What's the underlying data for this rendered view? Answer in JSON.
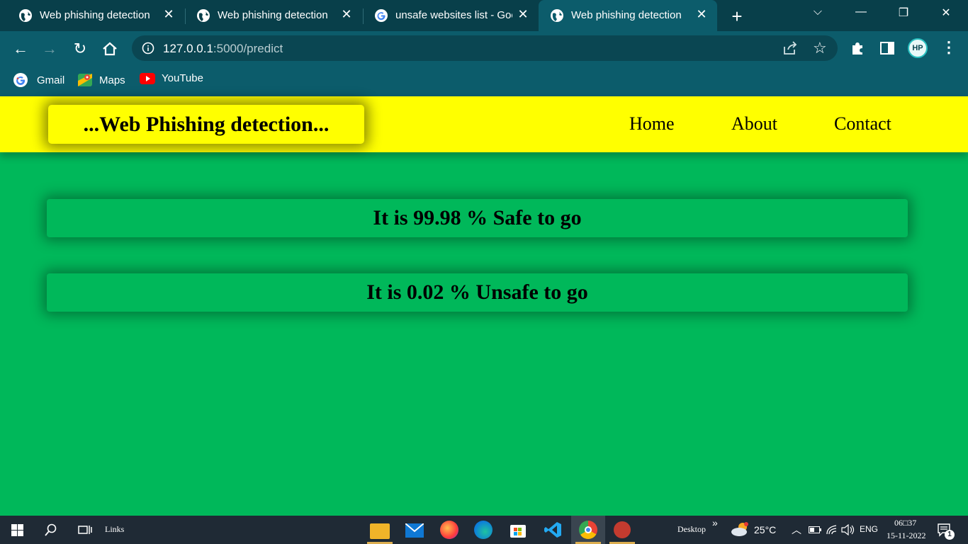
{
  "browser": {
    "tabs": [
      {
        "title": "Web phishing detection",
        "active": false
      },
      {
        "title": "Web phishing detection",
        "active": false
      },
      {
        "title": "unsafe websites list - Goo",
        "active": false
      },
      {
        "title": "Web phishing detection",
        "active": true
      }
    ],
    "url_host": "127.0.0.1",
    "url_path": ":5000/predict",
    "bookmarks": [
      "Gmail",
      "Maps",
      "YouTube"
    ],
    "profile_initials": "HP"
  },
  "page": {
    "brand": "...Web Phishing detection...",
    "nav": [
      "Home",
      "About",
      "Contact"
    ],
    "results": [
      "It is 99.98 % Safe to go",
      "It is 0.02 % Unsafe to go"
    ]
  },
  "taskbar": {
    "links_label": "Links",
    "desktop_label": "Desktop",
    "temperature": "25°C",
    "language": "ENG",
    "time": "06□37",
    "date": "15-11-2022",
    "notification_count": "1"
  },
  "colors": {
    "page_bg": "#00b85a",
    "header_bg": "#ffff00",
    "browser_frame": "#0c5c6b"
  }
}
